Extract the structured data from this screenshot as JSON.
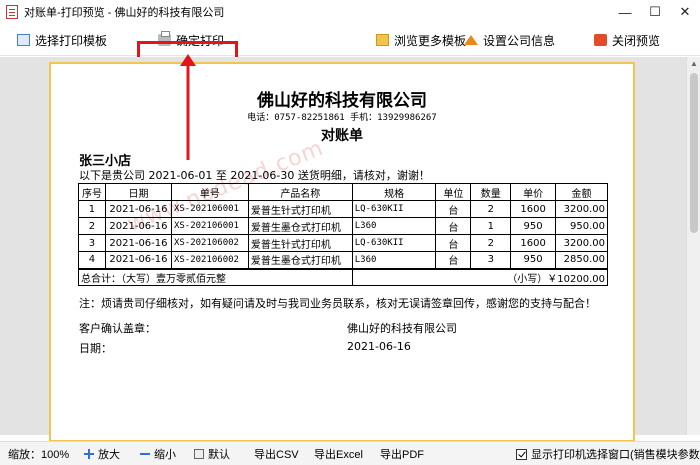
{
  "window": {
    "title": "对账单-打印预览 - 佛山好的科技有限公司",
    "minimize": "—",
    "maximize": "☐",
    "close": "✕"
  },
  "toolbar": {
    "select_template": "选择打印模板",
    "confirm_print": "确定打印",
    "browse_templates": "浏览更多模板",
    "company_settings": "设置公司信息",
    "close_preview": "关闭预览"
  },
  "document": {
    "company": "佛山好的科技有限公司",
    "contact": "电话：0757-82251861 手机：13929986267",
    "title": "对账单",
    "customer": "张三小店",
    "intro": "以下是贵公司 2021-06-01 至 2021-06-30 送货明细，请核对，谢谢！",
    "watermark": "www.nodead.com",
    "columns": [
      "序号",
      "日期",
      "单号",
      "产品名称",
      "规格",
      "单位",
      "数量",
      "单价",
      "金额"
    ],
    "rows": [
      {
        "no": "1",
        "date": "2021-06-16",
        "order": "XS-202106001",
        "product": "爱普生针式打印机",
        "spec": "LQ-630KII",
        "unit": "台",
        "qty": "2",
        "price": "1600",
        "amount": "3200.00"
      },
      {
        "no": "2",
        "date": "2021-06-16",
        "order": "XS-202106001",
        "product": "爱普生墨仓式打印机",
        "spec": "L360",
        "unit": "台",
        "qty": "1",
        "price": "950",
        "amount": "950.00"
      },
      {
        "no": "3",
        "date": "2021-06-16",
        "order": "XS-202106002",
        "product": "爱普生针式打印机",
        "spec": "LQ-630KII",
        "unit": "台",
        "qty": "2",
        "price": "1600",
        "amount": "3200.00"
      },
      {
        "no": "4",
        "date": "2021-06-16",
        "order": "XS-202106002",
        "product": "爱普生墨仓式打印机",
        "spec": "L360",
        "unit": "台",
        "qty": "3",
        "price": "950",
        "amount": "2850.00"
      }
    ],
    "total_upper": "总合计：（大写）壹万零贰佰元整",
    "total_lower": "（小写）￥10200.00",
    "note": "注：烦请贵司仔细核对，如有疑问请及时与我司业务员联系，核对无误请签章回传，感谢您的支持与配合！",
    "sign_customer": "客户确认盖章：",
    "sign_company": "佛山好的科技有限公司",
    "date_label": "日期：",
    "date_value": "2021-06-16"
  },
  "statusbar": {
    "zoom": "缩放：100%",
    "zoom_in": "放大",
    "zoom_out": "缩小",
    "default": "默认",
    "export_csv": "导出CSV",
    "export_excel": "导出Excel",
    "export_pdf": "导出PDF",
    "show_printer_dialog": "显示打印机选择窗口(销售模块参数)"
  },
  "colors": {
    "highlight": "#e3151a",
    "paper_border": "#f0c64f"
  }
}
